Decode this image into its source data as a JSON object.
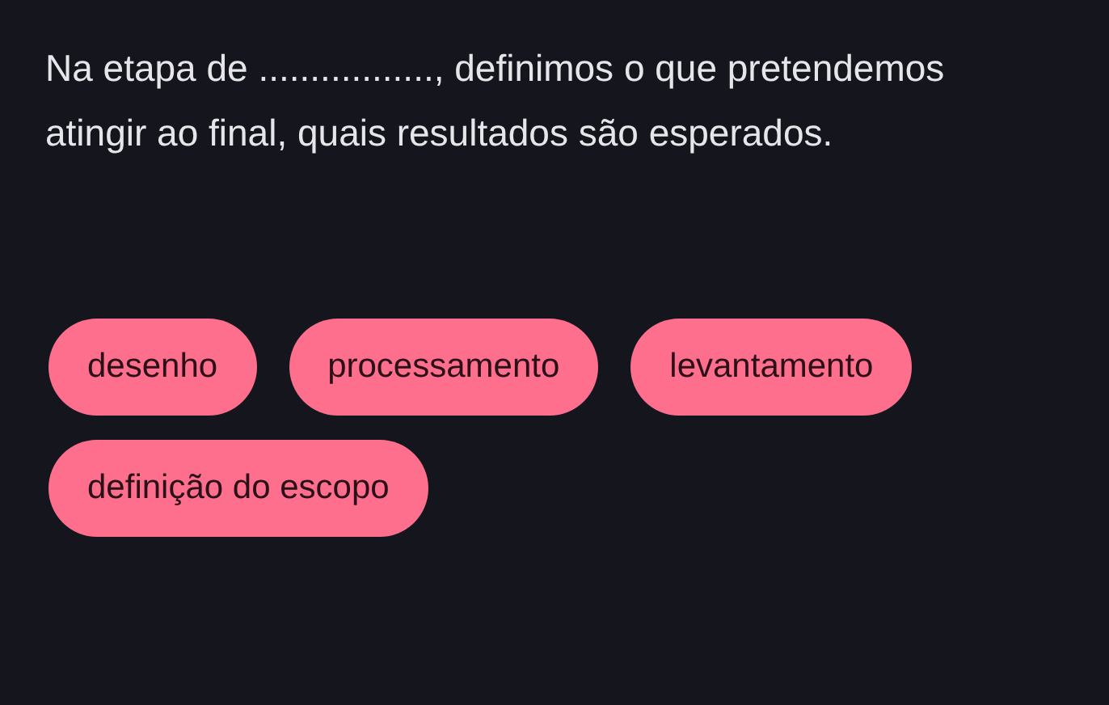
{
  "question": "Na etapa de ................., definimos o que pretendemos atingir ao final, quais resultados são esperados.",
  "options": [
    {
      "label": "desenho"
    },
    {
      "label": "processamento"
    },
    {
      "label": "levantamento"
    },
    {
      "label": "definição do escopo"
    }
  ]
}
